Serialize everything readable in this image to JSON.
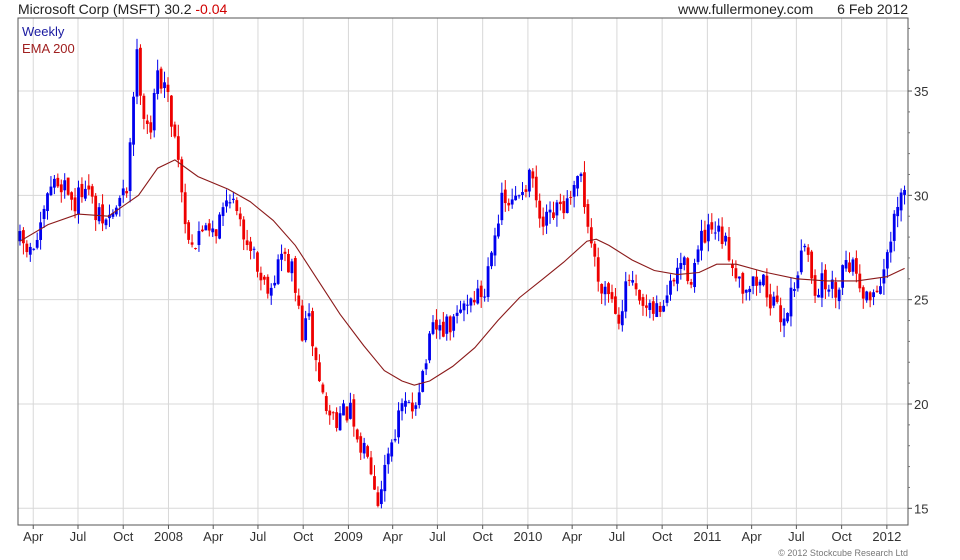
{
  "header": {
    "symbol_name": "Microsoft Corp (MSFT)",
    "last_price": "30.2",
    "change": "-0.04",
    "site": "www.fullermoney.com",
    "date": "6 Feb 2012"
  },
  "footer": {
    "copyright": "© 2012 Stockcube Research Ltd"
  },
  "colors": {
    "up": "#0000ee",
    "down": "#ee0000",
    "ema": "#8b1a1a",
    "grid": "#d8d8d8",
    "legend_weekly": "#1a1aa0",
    "legend_ema": "#a02020"
  },
  "chart_data": {
    "type": "candlestick",
    "legend": [
      "Weekly",
      "EMA 200"
    ],
    "legend_placement": "top-left",
    "y_axis_side": "right",
    "grid": true,
    "ylim": [
      14.2,
      38.5
    ],
    "y_ticks": [
      15,
      20,
      25,
      30,
      35
    ],
    "x_range": [
      "2007-03-01",
      "2012-02-13"
    ],
    "x_ticks": [
      {
        "label": "Apr",
        "date": "2007-04-01"
      },
      {
        "label": "Jul",
        "date": "2007-07-01"
      },
      {
        "label": "Oct",
        "date": "2007-10-01"
      },
      {
        "label": "2008",
        "date": "2008-01-01"
      },
      {
        "label": "Apr",
        "date": "2008-04-01"
      },
      {
        "label": "Jul",
        "date": "2008-07-01"
      },
      {
        "label": "Oct",
        "date": "2008-10-01"
      },
      {
        "label": "2009",
        "date": "2009-01-01"
      },
      {
        "label": "Apr",
        "date": "2009-04-01"
      },
      {
        "label": "Jul",
        "date": "2009-07-01"
      },
      {
        "label": "Oct",
        "date": "2009-10-01"
      },
      {
        "label": "2010",
        "date": "2010-01-01"
      },
      {
        "label": "Apr",
        "date": "2010-04-01"
      },
      {
        "label": "Jul",
        "date": "2010-07-01"
      },
      {
        "label": "Oct",
        "date": "2010-10-01"
      },
      {
        "label": "2011",
        "date": "2011-01-01"
      },
      {
        "label": "Apr",
        "date": "2011-04-01"
      },
      {
        "label": "Jul",
        "date": "2011-07-01"
      },
      {
        "label": "Oct",
        "date": "2011-10-01"
      },
      {
        "label": "2012",
        "date": "2012-01-01"
      }
    ],
    "price_path": [
      [
        "2007-03-05",
        27.8
      ],
      [
        "2007-03-26",
        27.2
      ],
      [
        "2007-04-16",
        28.2
      ],
      [
        "2007-05-07",
        30.5
      ],
      [
        "2007-06-04",
        30.6
      ],
      [
        "2007-06-25",
        29.5
      ],
      [
        "2007-07-16",
        30.8
      ],
      [
        "2007-08-06",
        29.0
      ],
      [
        "2007-08-27",
        28.7
      ],
      [
        "2007-09-17",
        29.4
      ],
      [
        "2007-10-08",
        30.3
      ],
      [
        "2007-10-22",
        35.0
      ],
      [
        "2007-10-29",
        36.6
      ],
      [
        "2007-11-12",
        34.0
      ],
      [
        "2007-11-26",
        33.2
      ],
      [
        "2007-12-10",
        35.8
      ],
      [
        "2007-12-24",
        35.4
      ],
      [
        "2008-01-07",
        33.7
      ],
      [
        "2008-01-21",
        32.0
      ],
      [
        "2008-02-04",
        28.6
      ],
      [
        "2008-02-25",
        27.6
      ],
      [
        "2008-03-17",
        28.8
      ],
      [
        "2008-04-07",
        28.4
      ],
      [
        "2008-05-05",
        30.2
      ],
      [
        "2008-05-26",
        28.4
      ],
      [
        "2008-06-16",
        27.8
      ],
      [
        "2008-07-07",
        26.0
      ],
      [
        "2008-07-28",
        25.7
      ],
      [
        "2008-08-18",
        27.2
      ],
      [
        "2008-09-08",
        26.4
      ],
      [
        "2008-09-29",
        23.4
      ],
      [
        "2008-10-13",
        24.0
      ],
      [
        "2008-10-27",
        22.0
      ],
      [
        "2008-11-17",
        19.6
      ],
      [
        "2008-12-08",
        19.4
      ],
      [
        "2009-01-05",
        19.6
      ],
      [
        "2009-01-19",
        17.8
      ],
      [
        "2009-02-09",
        18.0
      ],
      [
        "2009-03-02",
        15.5
      ],
      [
        "2009-03-23",
        17.8
      ],
      [
        "2009-04-20",
        19.8
      ],
      [
        "2009-05-11",
        19.8
      ],
      [
        "2009-06-01",
        21.5
      ],
      [
        "2009-06-22",
        23.5
      ],
      [
        "2009-07-13",
        23.6
      ],
      [
        "2009-08-03",
        23.8
      ],
      [
        "2009-08-24",
        24.8
      ],
      [
        "2009-09-14",
        25.2
      ],
      [
        "2009-10-05",
        25.3
      ],
      [
        "2009-10-19",
        27.8
      ],
      [
        "2009-11-09",
        29.6
      ],
      [
        "2009-11-30",
        29.5
      ],
      [
        "2009-12-21",
        30.5
      ],
      [
        "2010-01-11",
        30.8
      ],
      [
        "2010-01-25",
        28.4
      ],
      [
        "2010-02-15",
        28.8
      ],
      [
        "2010-03-08",
        29.4
      ],
      [
        "2010-03-29",
        29.6
      ],
      [
        "2010-04-19",
        30.9
      ],
      [
        "2010-05-03",
        28.6
      ],
      [
        "2010-05-24",
        26.0
      ],
      [
        "2010-06-14",
        25.5
      ],
      [
        "2010-07-05",
        24.3
      ],
      [
        "2010-07-26",
        26.0
      ],
      [
        "2010-08-16",
        24.6
      ],
      [
        "2010-09-06",
        24.3
      ],
      [
        "2010-09-27",
        24.6
      ],
      [
        "2010-10-18",
        25.5
      ],
      [
        "2010-11-08",
        26.8
      ],
      [
        "2010-11-29",
        26.1
      ],
      [
        "2010-12-20",
        27.8
      ],
      [
        "2011-01-10",
        28.2
      ],
      [
        "2011-01-31",
        27.9
      ],
      [
        "2011-02-21",
        26.8
      ],
      [
        "2011-03-14",
        25.7
      ],
      [
        "2011-04-04",
        25.8
      ],
      [
        "2011-04-25",
        25.9
      ],
      [
        "2011-05-16",
        24.6
      ],
      [
        "2011-06-06",
        24.1
      ],
      [
        "2011-06-27",
        25.9
      ],
      [
        "2011-07-18",
        27.6
      ],
      [
        "2011-08-08",
        25.6
      ],
      [
        "2011-08-29",
        25.8
      ],
      [
        "2011-09-19",
        25.4
      ],
      [
        "2011-10-10",
        27.1
      ],
      [
        "2011-10-31",
        26.4
      ],
      [
        "2011-11-21",
        25.0
      ],
      [
        "2011-12-12",
        25.6
      ],
      [
        "2012-01-02",
        26.8
      ],
      [
        "2012-01-16",
        28.6
      ],
      [
        "2012-01-30",
        29.9
      ],
      [
        "2012-02-06",
        30.2
      ]
    ],
    "ema200": [
      [
        "2007-03-05",
        27.8
      ],
      [
        "2007-05-01",
        28.6
      ],
      [
        "2007-07-01",
        29.1
      ],
      [
        "2007-09-01",
        29.0
      ],
      [
        "2007-11-01",
        30.0
      ],
      [
        "2007-12-10",
        31.3
      ],
      [
        "2008-01-14",
        31.7
      ],
      [
        "2008-03-01",
        30.9
      ],
      [
        "2008-05-01",
        30.3
      ],
      [
        "2008-06-15",
        29.7
      ],
      [
        "2008-08-01",
        28.8
      ],
      [
        "2008-09-15",
        27.6
      ],
      [
        "2008-11-01",
        25.9
      ],
      [
        "2008-12-15",
        24.3
      ],
      [
        "2009-02-01",
        22.8
      ],
      [
        "2009-03-15",
        21.6
      ],
      [
        "2009-04-20",
        21.1
      ],
      [
        "2009-05-15",
        20.9
      ],
      [
        "2009-06-15",
        21.1
      ],
      [
        "2009-08-01",
        21.8
      ],
      [
        "2009-09-15",
        22.7
      ],
      [
        "2009-11-01",
        24.0
      ],
      [
        "2009-12-15",
        25.1
      ],
      [
        "2010-02-01",
        26.0
      ],
      [
        "2010-03-15",
        26.8
      ],
      [
        "2010-05-01",
        27.8
      ],
      [
        "2010-05-20",
        27.9
      ],
      [
        "2010-06-15",
        27.6
      ],
      [
        "2010-08-01",
        26.9
      ],
      [
        "2010-09-15",
        26.4
      ],
      [
        "2010-11-01",
        26.2
      ],
      [
        "2010-12-15",
        26.3
      ],
      [
        "2011-01-20",
        26.7
      ],
      [
        "2011-03-01",
        26.7
      ],
      [
        "2011-05-01",
        26.3
      ],
      [
        "2011-07-01",
        26.0
      ],
      [
        "2011-09-01",
        25.9
      ],
      [
        "2011-11-01",
        25.9
      ],
      [
        "2012-01-01",
        26.1
      ],
      [
        "2012-02-06",
        26.5
      ]
    ]
  }
}
